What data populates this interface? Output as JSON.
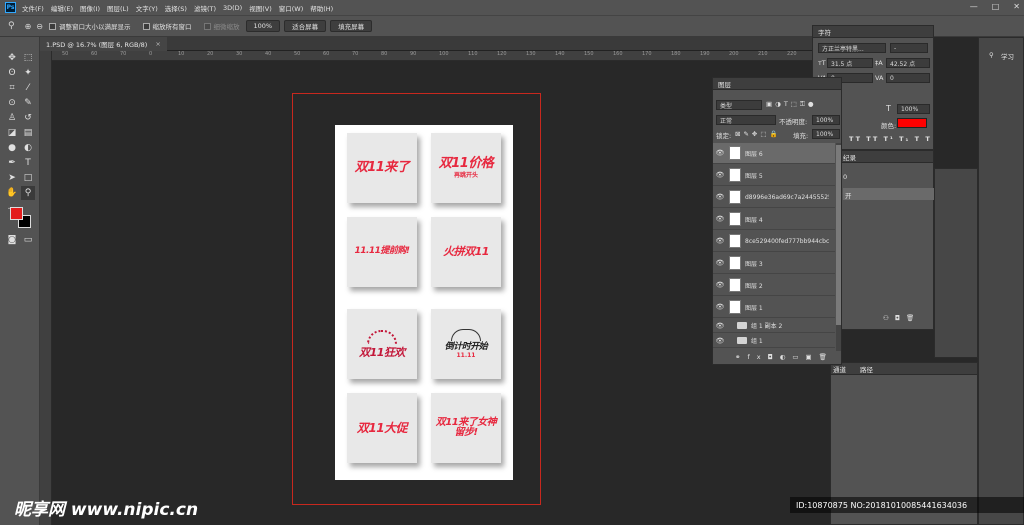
{
  "app": {
    "logo": "Ps"
  },
  "menu": [
    "文件(F)",
    "编辑(E)",
    "图像(I)",
    "图层(L)",
    "文字(Y)",
    "选择(S)",
    "滤镜(T)",
    "3D(D)",
    "视图(V)",
    "窗口(W)",
    "帮助(H)"
  ],
  "window_controls": {
    "minimize": "—",
    "maximize": "□",
    "close": "✕"
  },
  "options": {
    "zoom_icon": "magnifier-icon",
    "resize_window": "调整窗口大小以满屏显示",
    "zoom_all": "缩放所有窗口",
    "scrubby": "细微缩放",
    "zoom_level": "100%",
    "fit_screen": "适合屏幕",
    "fill_screen": "填充屏幕"
  },
  "document_tab": {
    "title": "1.PSD @ 16.7% (图层 6, RGB/8)",
    "close": "×"
  },
  "ruler_ticks": [
    "50",
    "60",
    "70",
    "0",
    "10",
    "20",
    "30",
    "40",
    "50",
    "60",
    "70",
    "80",
    "90",
    "100",
    "110",
    "120",
    "130",
    "140",
    "150",
    "160",
    "170",
    "180",
    "190",
    "200",
    "210",
    "220"
  ],
  "canvas_logos": [
    {
      "main": "双11来了",
      "sub": ""
    },
    {
      "main": "双11价格",
      "sub": "再跳开头"
    },
    {
      "main": "11.11提前购!",
      "sub": ""
    },
    {
      "main": "火拼双11",
      "sub": ""
    },
    {
      "main": "双11狂欢",
      "sub": ""
    },
    {
      "main": "倒计时开始",
      "sub": "11.11"
    },
    {
      "main": "双11大促",
      "sub": ""
    },
    {
      "main": "双11来了女神留步!",
      "sub": ""
    }
  ],
  "character_panel": {
    "title": "字符",
    "font_family": "方正兰亭特黑...",
    "font_style": "-",
    "font_size": "31.5 点",
    "leading": "42.52 点",
    "tracking_a": "0",
    "tracking_b": "0",
    "scale": "100%",
    "color_label": "颜色:",
    "color": "#ff0000"
  },
  "layers_panel": {
    "title": "图层",
    "filter": "类型",
    "blend_mode": "正常",
    "opacity_label": "不透明度:",
    "opacity": "100%",
    "lock_label": "锁定:",
    "fill_label": "填充:",
    "fill": "100%",
    "layers": [
      {
        "name": "图层 6",
        "selected": true,
        "kind": "layer"
      },
      {
        "name": "图层 5",
        "selected": false,
        "kind": "layer"
      },
      {
        "name": "d8996e36ad69c7a24455525...",
        "selected": false,
        "kind": "layer"
      },
      {
        "name": "图层 4",
        "selected": false,
        "kind": "layer"
      },
      {
        "name": "8ce529400fed777bb944cbc0...",
        "selected": false,
        "kind": "layer"
      },
      {
        "name": "图层 3",
        "selected": false,
        "kind": "layer"
      },
      {
        "name": "图层 2",
        "selected": false,
        "kind": "layer"
      },
      {
        "name": "图层 1",
        "selected": false,
        "kind": "layer"
      },
      {
        "name": "组 1 副本 2",
        "selected": false,
        "kind": "group"
      },
      {
        "name": "组 1",
        "selected": false,
        "kind": "group"
      }
    ]
  },
  "history_panel": {
    "title": "纪录",
    "item1": "0",
    "item2": "开"
  },
  "right_dock": {
    "learn": "学习",
    "tab_channels": "通道",
    "tab_paths": "路径"
  },
  "colors": {
    "foreground": "#e31c1c",
    "background": "#000000",
    "artboard_border": "#c8281e",
    "logo_red": "#e7283f"
  },
  "watermark": {
    "left": "昵享网 www.nipic.cn",
    "id": "ID:10870875 NO:20181010085441634036"
  }
}
